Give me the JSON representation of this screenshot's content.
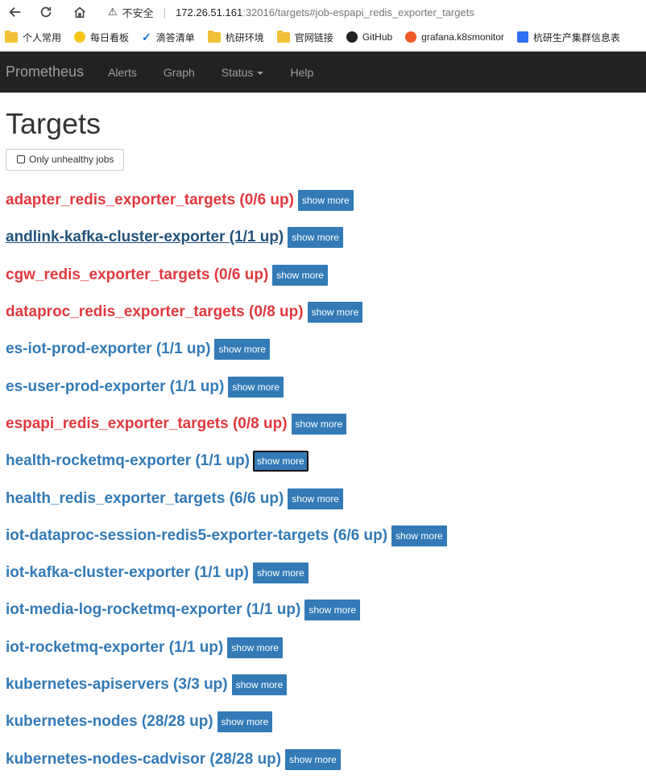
{
  "browser": {
    "back_icon": "back-arrow-icon",
    "reload_icon": "reload-icon",
    "home_icon": "home-icon",
    "security_label": "不安全",
    "url_host": "172.26.51.161",
    "url_rest": ":32016/targets#job-espapi_redis_exporter_targets"
  },
  "bookmarks": [
    {
      "label": "个人常用"
    },
    {
      "label": "每日看板"
    },
    {
      "label": "滴答清单"
    },
    {
      "label": "杭研环境"
    },
    {
      "label": "官网链接"
    },
    {
      "label": "GitHub"
    },
    {
      "label": "grafana.k8smonitor"
    },
    {
      "label": "杭研生产集群信息表"
    }
  ],
  "navbar": {
    "brand": "Prometheus",
    "alerts": "Alerts",
    "graph": "Graph",
    "status": "Status",
    "help": "Help"
  },
  "page": {
    "title": "Targets",
    "filter_label": "Only unhealthy jobs",
    "show_more_label": "show more"
  },
  "jobs": [
    {
      "title": "adapter_redis_exporter_targets (0/6 up)",
      "state": "down"
    },
    {
      "title": "andlink-kafka-cluster-exporter (1/1 up)",
      "state": "visited"
    },
    {
      "title": "cgw_redis_exporter_targets (0/6 up)",
      "state": "down"
    },
    {
      "title": "dataproc_redis_exporter_targets (0/8 up)",
      "state": "down"
    },
    {
      "title": "es-iot-prod-exporter (1/1 up)",
      "state": "up"
    },
    {
      "title": "es-user-prod-exporter (1/1 up)",
      "state": "up"
    },
    {
      "title": "espapi_redis_exporter_targets (0/8 up)",
      "state": "down"
    },
    {
      "title": "health-rocketmq-exporter (1/1 up)",
      "state": "up"
    },
    {
      "title": "health_redis_exporter_targets (6/6 up)",
      "state": "up"
    },
    {
      "title": "iot-dataproc-session-redis5-exporter-targets (6/6 up)",
      "state": "up"
    },
    {
      "title": "iot-kafka-cluster-exporter (1/1 up)",
      "state": "up"
    },
    {
      "title": "iot-media-log-rocketmq-exporter (1/1 up)",
      "state": "up"
    },
    {
      "title": "iot-rocketmq-exporter (1/1 up)",
      "state": "up"
    },
    {
      "title": "kubernetes-apiservers (3/3 up)",
      "state": "up"
    },
    {
      "title": "kubernetes-nodes (28/28 up)",
      "state": "up"
    },
    {
      "title": "kubernetes-nodes-cadvisor (28/28 up)",
      "state": "up"
    }
  ],
  "colors": {
    "up": "#337ab7",
    "down": "#e0393e",
    "navbar_bg": "#222222",
    "button_bg": "#337ab7"
  }
}
